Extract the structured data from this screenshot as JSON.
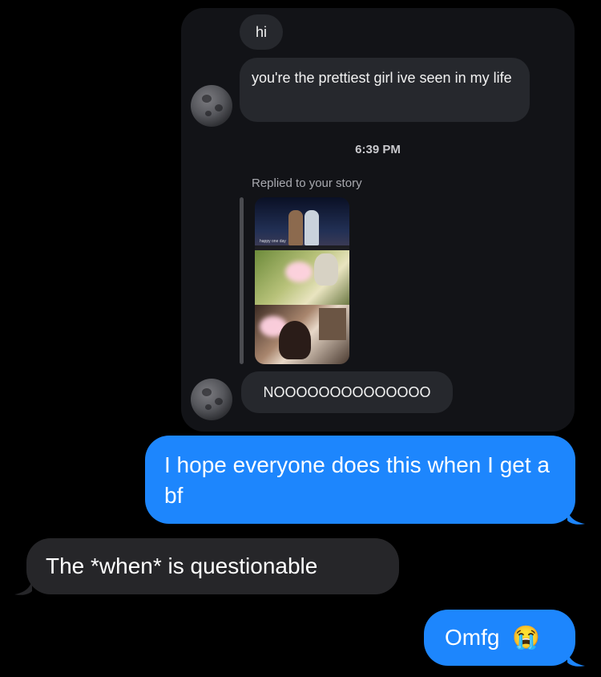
{
  "instagram_thread": {
    "messages": [
      {
        "text": "hi"
      },
      {
        "text": "you're the prettiest girl ive seen in my life"
      }
    ],
    "timestamp": "6:39 PM",
    "reply_label": "Replied to your story",
    "reply_text": "NOOOOOOOOOOOOOO",
    "avatar_icon": "moon-icon"
  },
  "imessage": {
    "messages": [
      {
        "sender": "me",
        "text": "I hope everyone does this when I get a bf"
      },
      {
        "sender": "them",
        "text": "The *when* is questionable"
      },
      {
        "sender": "me",
        "text": "Omfg",
        "emoji": "😭",
        "emoji_icon": "loudly-crying-face-icon"
      }
    ]
  },
  "colors": {
    "sent_bubble": "#1d86fd",
    "received_bubble": "#262629",
    "ig_bubble": "#26282d",
    "background": "#000000"
  }
}
